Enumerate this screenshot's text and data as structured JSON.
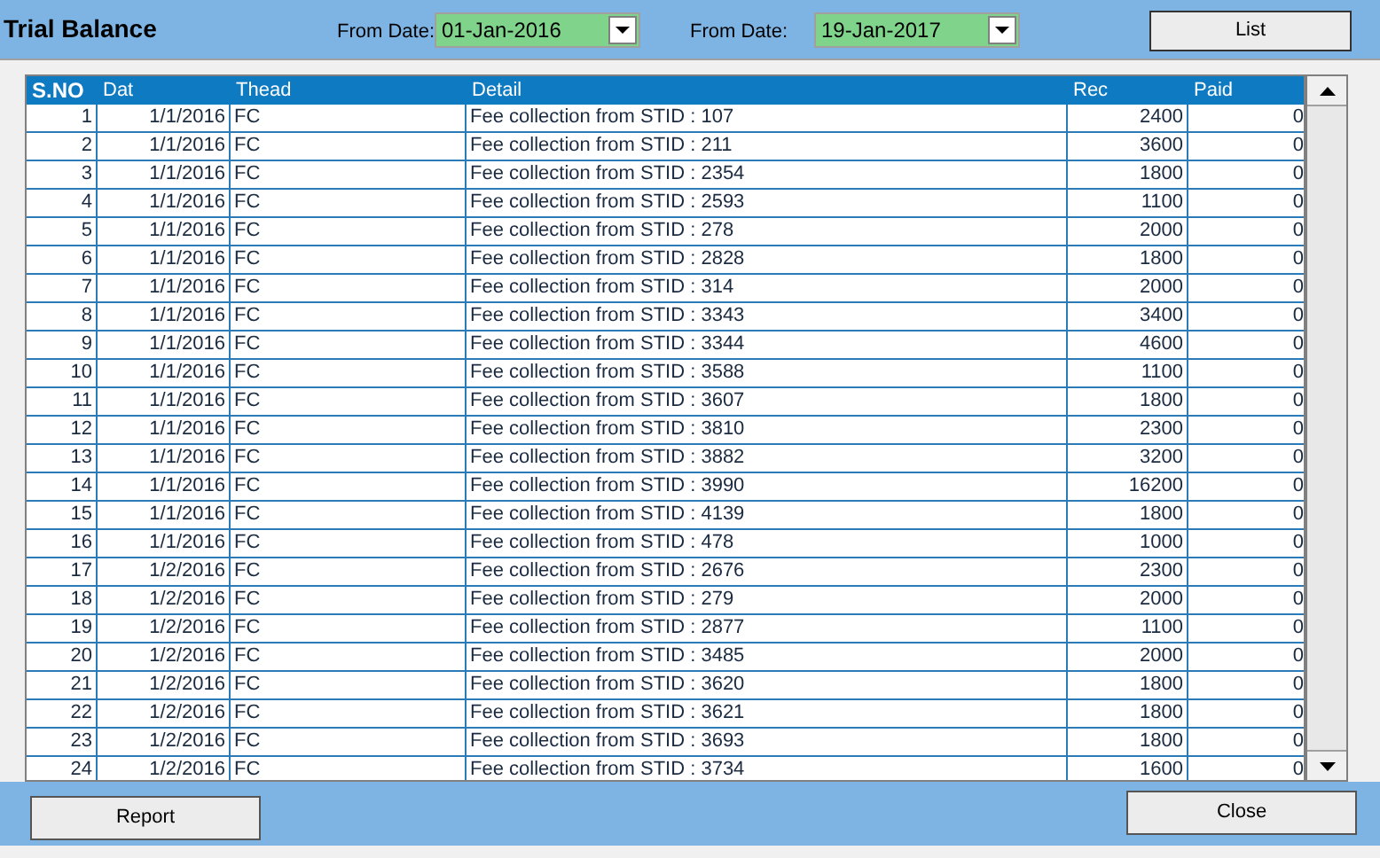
{
  "window": {
    "title": "Trial Balance"
  },
  "filters": [
    {
      "label": "From Date:",
      "value": "01-Jan-2016"
    },
    {
      "label": "From Date:",
      "value": "19-Jan-2017"
    }
  ],
  "list_button": "List",
  "table": {
    "columns": [
      "S.NO",
      "Dat",
      "Thead",
      "Detail",
      "Rec",
      "Paid"
    ],
    "rows": [
      [
        "1",
        "1/1/2016",
        "FC",
        "Fee collection from STID : 107",
        "2400",
        "0"
      ],
      [
        "2",
        "1/1/2016",
        "FC",
        "Fee collection from STID : 211",
        "3600",
        "0"
      ],
      [
        "3",
        "1/1/2016",
        "FC",
        "Fee collection from STID : 2354",
        "1800",
        "0"
      ],
      [
        "4",
        "1/1/2016",
        "FC",
        "Fee collection from STID : 2593",
        "1100",
        "0"
      ],
      [
        "5",
        "1/1/2016",
        "FC",
        "Fee collection from STID : 278",
        "2000",
        "0"
      ],
      [
        "6",
        "1/1/2016",
        "FC",
        "Fee collection from STID : 2828",
        "1800",
        "0"
      ],
      [
        "7",
        "1/1/2016",
        "FC",
        "Fee collection from STID : 314",
        "2000",
        "0"
      ],
      [
        "8",
        "1/1/2016",
        "FC",
        "Fee collection from STID : 3343",
        "3400",
        "0"
      ],
      [
        "9",
        "1/1/2016",
        "FC",
        "Fee collection from STID : 3344",
        "4600",
        "0"
      ],
      [
        "10",
        "1/1/2016",
        "FC",
        "Fee collection from STID : 3588",
        "1100",
        "0"
      ],
      [
        "11",
        "1/1/2016",
        "FC",
        "Fee collection from STID : 3607",
        "1800",
        "0"
      ],
      [
        "12",
        "1/1/2016",
        "FC",
        "Fee collection from STID : 3810",
        "2300",
        "0"
      ],
      [
        "13",
        "1/1/2016",
        "FC",
        "Fee collection from STID : 3882",
        "3200",
        "0"
      ],
      [
        "14",
        "1/1/2016",
        "FC",
        "Fee collection from STID : 3990",
        "16200",
        "0"
      ],
      [
        "15",
        "1/1/2016",
        "FC",
        "Fee collection from STID : 4139",
        "1800",
        "0"
      ],
      [
        "16",
        "1/1/2016",
        "FC",
        "Fee collection from STID : 478",
        "1000",
        "0"
      ],
      [
        "17",
        "1/2/2016",
        "FC",
        "Fee collection from STID : 2676",
        "2300",
        "0"
      ],
      [
        "18",
        "1/2/2016",
        "FC",
        "Fee collection from STID : 279",
        "2000",
        "0"
      ],
      [
        "19",
        "1/2/2016",
        "FC",
        "Fee collection from STID : 2877",
        "1100",
        "0"
      ],
      [
        "20",
        "1/2/2016",
        "FC",
        "Fee collection from STID : 3485",
        "2000",
        "0"
      ],
      [
        "21",
        "1/2/2016",
        "FC",
        "Fee collection from STID : 3620",
        "1800",
        "0"
      ],
      [
        "22",
        "1/2/2016",
        "FC",
        "Fee collection from STID : 3621",
        "1800",
        "0"
      ],
      [
        "23",
        "1/2/2016",
        "FC",
        "Fee collection from STID : 3693",
        "1800",
        "0"
      ],
      [
        "24",
        "1/2/2016",
        "FC",
        "Fee collection from STID : 3734",
        "1600",
        "0"
      ]
    ]
  },
  "buttons": [
    "Report",
    "Close"
  ]
}
